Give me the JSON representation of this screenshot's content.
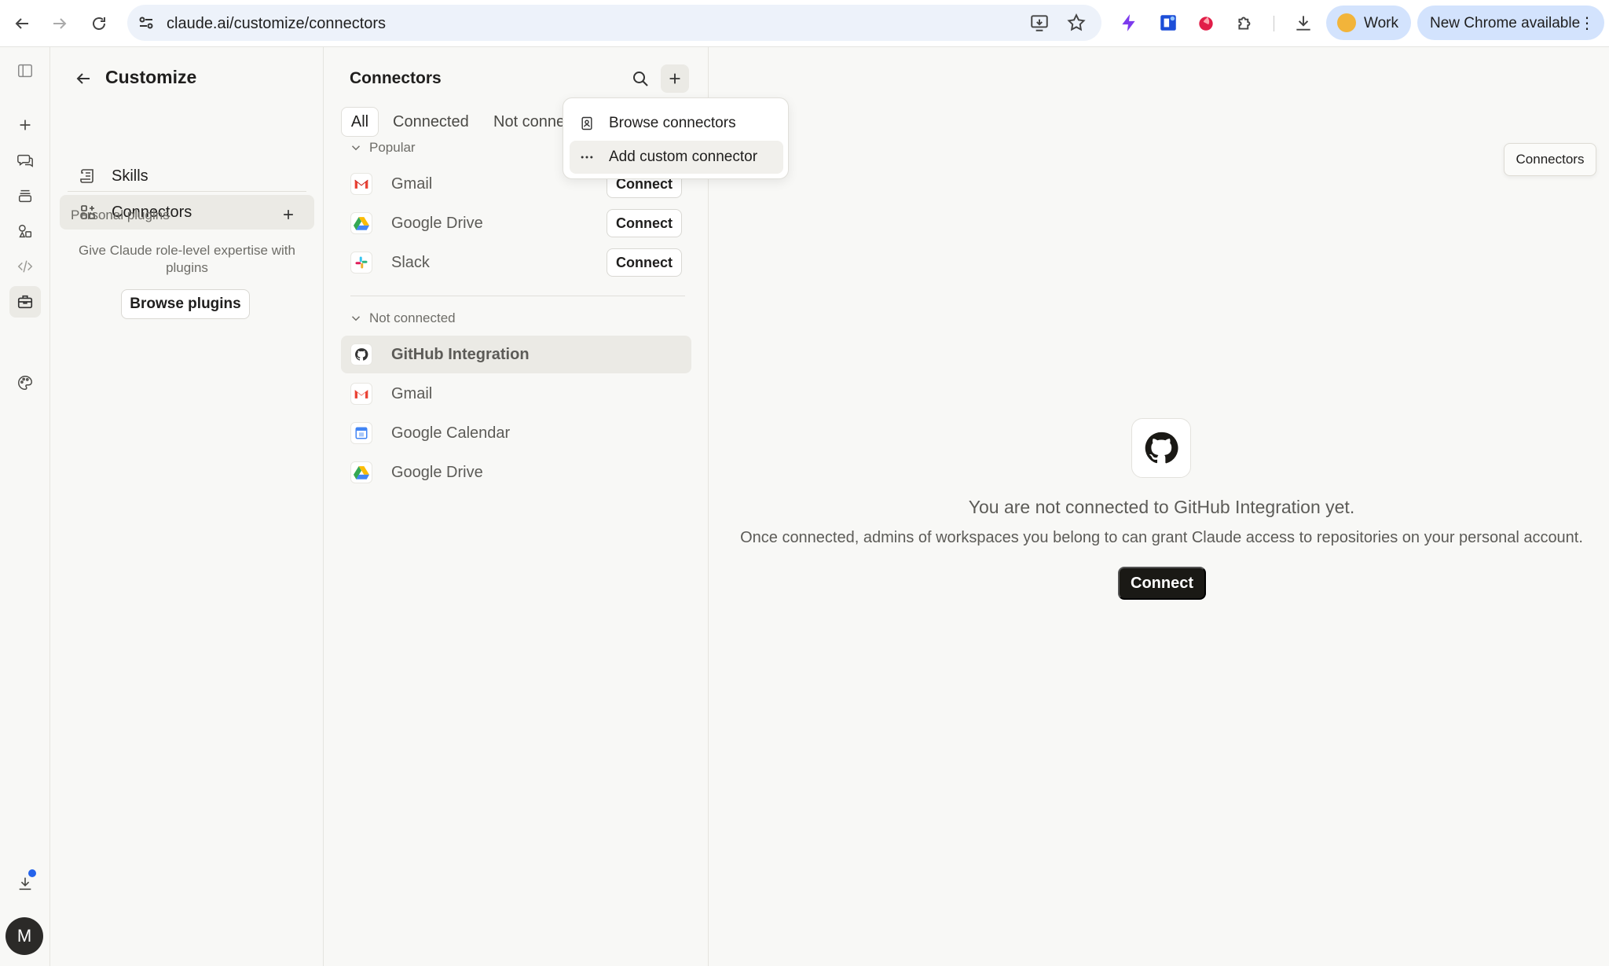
{
  "browser": {
    "url": "claude.ai/customize/connectors",
    "profile_label": "Work",
    "update_label": "New Chrome available"
  },
  "rail": {
    "avatar_letter": "M"
  },
  "customize": {
    "title": "Customize",
    "nav": [
      {
        "label": "Skills",
        "active": false
      },
      {
        "label": "Connectors",
        "active": true
      }
    ],
    "personal_plugins_label": "Personal plugins",
    "plugins_desc": "Give Claude role-level expertise with plugins",
    "browse_plugins_label": "Browse plugins"
  },
  "connectors": {
    "title": "Connectors",
    "tabs": [
      "All",
      "Connected",
      "Not conne"
    ],
    "popular_label": "Popular",
    "popular": [
      {
        "name": "Gmail",
        "action": "Connect"
      },
      {
        "name": "Google Drive",
        "action": "Connect"
      },
      {
        "name": "Slack",
        "action": "Connect"
      }
    ],
    "not_connected_label": "Not connected",
    "not_connected": [
      {
        "name": "GitHub Integration"
      },
      {
        "name": "Gmail"
      },
      {
        "name": "Google Calendar"
      },
      {
        "name": "Google Drive"
      }
    ]
  },
  "menu": {
    "items": [
      "Browse connectors",
      "Add custom connector"
    ]
  },
  "detail": {
    "title": "You are not connected to GitHub Integration yet.",
    "description": "Once connected, admins of workspaces you belong to can grant Claude access to repositories on your personal account.",
    "connect_label": "Connect"
  },
  "tooltip": "Connectors",
  "colors": {
    "accent_blue": "#2463eb",
    "chip_bg": "#d3e3fd",
    "primary_button": "#1a1915"
  }
}
